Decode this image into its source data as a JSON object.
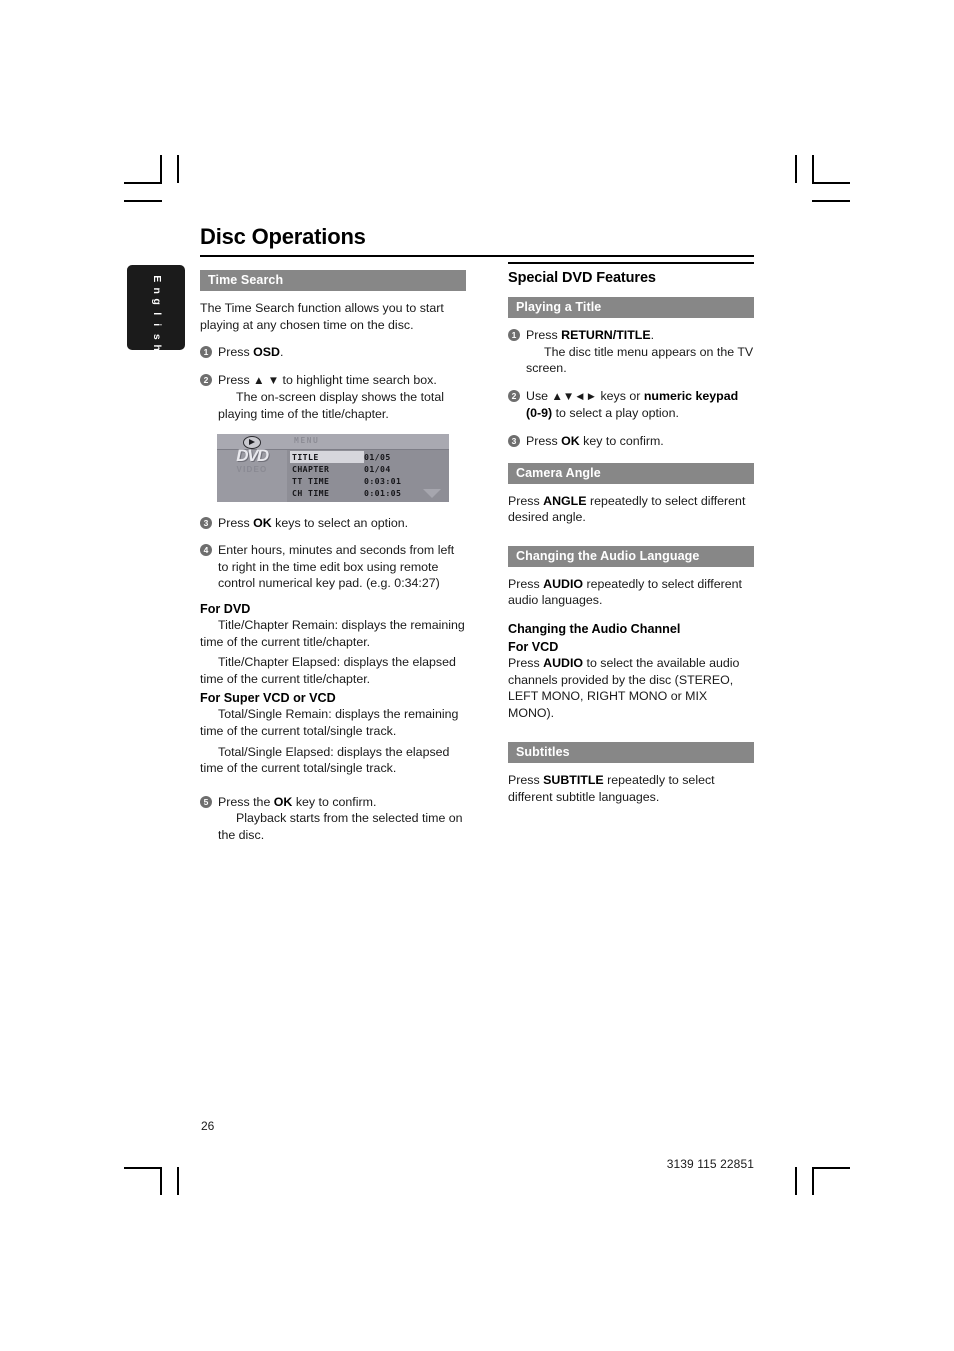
{
  "page": {
    "title": "Disc Operations",
    "language_tab": "English",
    "page_number": "26",
    "doc_code": "3139 115 22851"
  },
  "left_column": {
    "section_bar": "Time Search",
    "intro": "The Time Search function allows you to start playing at any chosen time on the disc.",
    "steps": [
      {
        "num": "1",
        "main_pre": "Press ",
        "main_bold": "OSD",
        "main_post": "."
      },
      {
        "num": "2",
        "main_pre": "Press ",
        "arrows": "▲ ▼",
        "main_post": " to highlight time search box.",
        "cont": "The on-screen display shows the total playing time of the title/chapter."
      },
      {
        "num": "3",
        "main_pre": "Press ",
        "main_bold": "OK",
        "main_post": " keys to select an option."
      },
      {
        "num": "4",
        "main_post": "Enter hours, minutes and seconds from left to right in the time edit box using remote control numerical key pad. (e.g. 0:34:27)"
      },
      {
        "num": "5",
        "main_pre": "Press the ",
        "main_bold": "OK",
        "main_post": " key to confirm.",
        "cont": "Playback starts from the selected time on the disc."
      }
    ],
    "osd": {
      "menu_label": "MENU",
      "logo_main": "DVD",
      "logo_sub": "VIDEO",
      "rows": [
        {
          "label": "TITLE",
          "value": "01/05",
          "selected": true
        },
        {
          "label": "CHAPTER",
          "value": "01/04",
          "selected": false
        },
        {
          "label": "TT  TIME",
          "value": "0:03:01",
          "selected": false
        },
        {
          "label": "CH  TIME",
          "value": "0:01:05",
          "selected": false
        }
      ]
    },
    "for_dvd": {
      "heading": "For DVD",
      "para1": "Title/Chapter Remain: displays the remaining time of the current title/chapter.",
      "para2": "Title/Chapter Elapsed: displays the elapsed time of the current title/chapter."
    },
    "for_svcd": {
      "heading": "For Super VCD or VCD",
      "para1": "Total/Single Remain: displays the remaining time of the current total/single track.",
      "para2": "Total/Single Elapsed: displays the elapsed time of the current total/single track."
    }
  },
  "right_column": {
    "section_title": "Special DVD Features",
    "playing_title": {
      "bar": "Playing a Title",
      "step1": {
        "num": "1",
        "pre": "Press ",
        "bold": "RETURN/TITLE",
        "post": ".",
        "cont": "The disc title menu appears on the TV screen."
      },
      "step2": {
        "num": "2",
        "pre": "Use ",
        "arrows": "▲▼◄►",
        "mid": " keys or ",
        "bold": "numeric keypad (0-9)",
        "post": " to select a play option."
      },
      "step3": {
        "num": "3",
        "pre": "Press ",
        "bold": "OK",
        "post": " key to confirm."
      }
    },
    "camera_angle": {
      "bar": "Camera Angle",
      "pre": "Press ",
      "bold": "ANGLE",
      "post": " repeatedly to select different desired angle."
    },
    "audio_language": {
      "bar": "Changing the Audio Language",
      "pre": "Press ",
      "bold": "AUDIO",
      "post": " repeatedly to select different audio languages."
    },
    "audio_channel": {
      "heading": "Changing the Audio Channel",
      "sub_heading": "For VCD",
      "pre": "Press ",
      "bold": "AUDIO",
      "post": " to select the available audio channels provided by the disc (STEREO, LEFT MONO, RIGHT MONO or MIX MONO)."
    },
    "subtitles": {
      "bar": "Subtitles",
      "pre": "Press ",
      "bold": "SUBTITLE",
      "post": " repeatedly to select different subtitle languages."
    }
  },
  "colors": {
    "section_bar": "#878787",
    "bullet": "#6e6e6e",
    "tab": "#1b1b1b"
  }
}
